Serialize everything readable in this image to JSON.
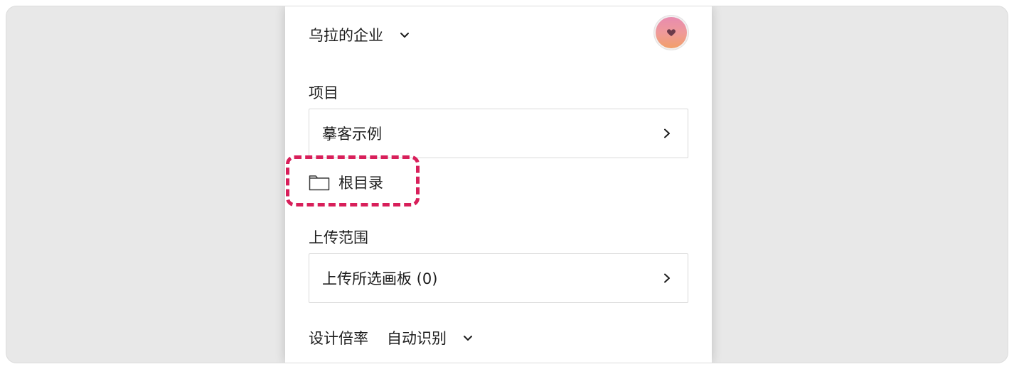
{
  "header": {
    "org_name": "乌拉的企业",
    "org_chevron_icon": "chevron-down-icon",
    "avatar_icon": "heart-icon"
  },
  "project": {
    "label": "项目",
    "selected": "摹客示例",
    "arrow_icon": "chevron-right-icon"
  },
  "folder": {
    "icon": "folder-icon",
    "label": "根目录",
    "highlight_color": "#d81f5a"
  },
  "upload_scope": {
    "label": "上传范围",
    "selected": "上传所选画板 (0)",
    "arrow_icon": "chevron-right-icon"
  },
  "design_scale": {
    "label": "设计倍率",
    "value": "自动识别",
    "chevron_icon": "chevron-down-icon"
  }
}
